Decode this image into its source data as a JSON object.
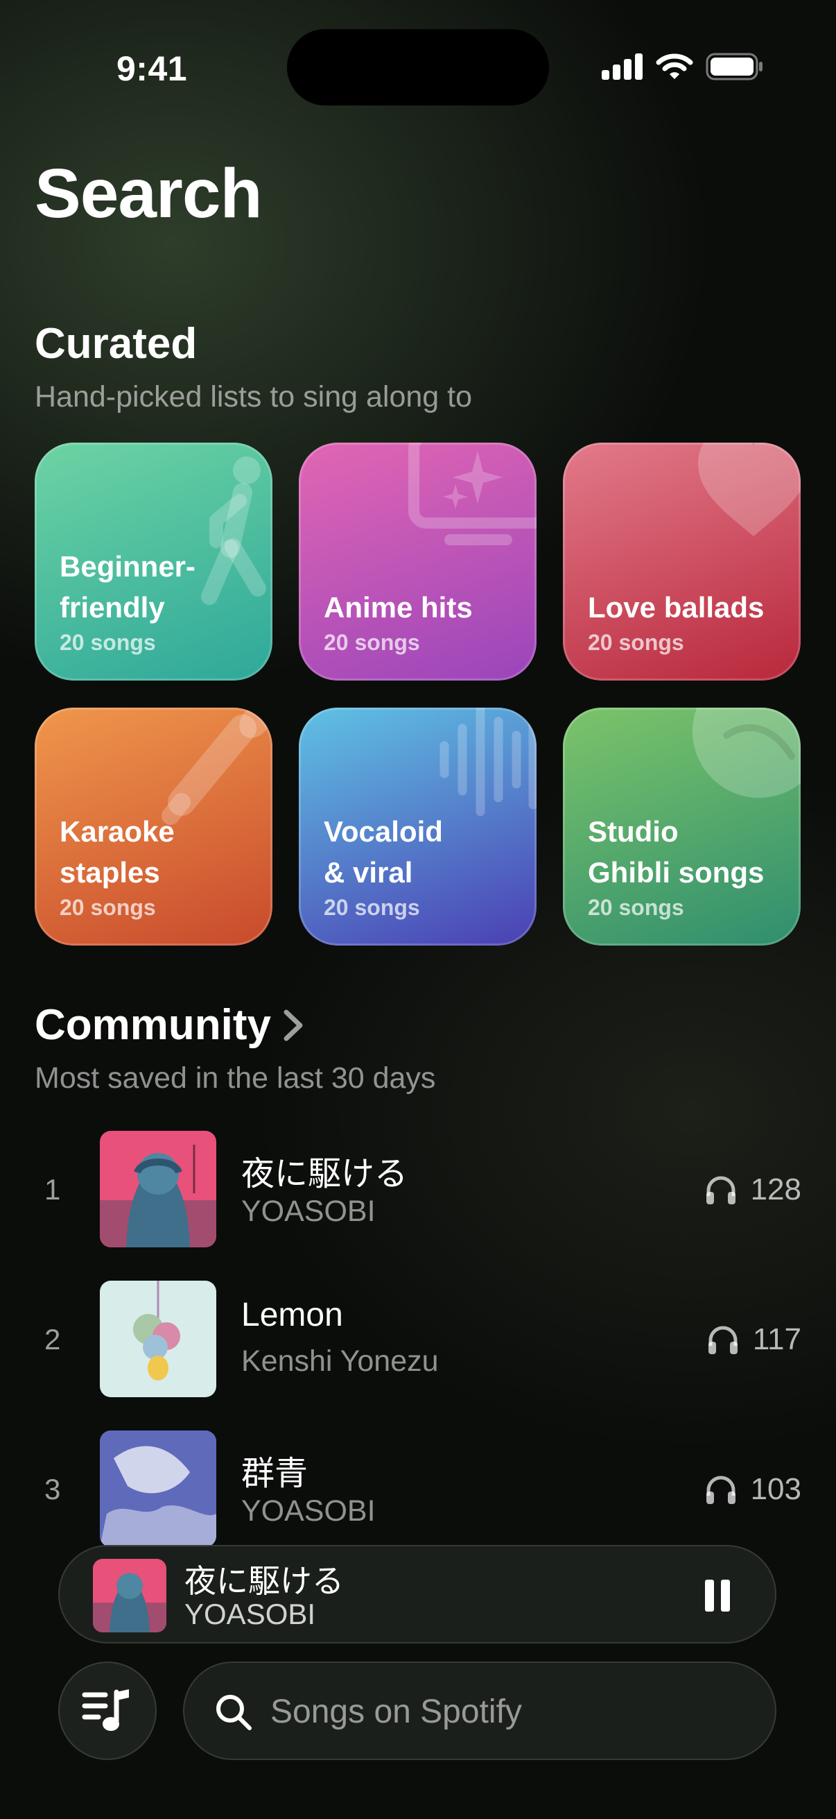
{
  "status_bar": {
    "time": "9:41"
  },
  "page": {
    "title": "Search"
  },
  "curated": {
    "title": "Curated",
    "subtitle": "Hand-picked lists to sing along to",
    "tiles": [
      {
        "title": "Beginner-\nfriendly",
        "count": "20 songs",
        "icon": "walking-person-icon",
        "colors": [
          "#6dd3a3",
          "#2ea89a"
        ]
      },
      {
        "title": "Anime hits",
        "count": "20 songs",
        "icon": "tv-sparkle-icon",
        "colors": [
          "#e266b3",
          "#9a45bb"
        ]
      },
      {
        "title": "Love ballads",
        "count": "20 songs",
        "icon": "heart-icon",
        "colors": [
          "#e27a8a",
          "#b8283b"
        ]
      },
      {
        "title": "Karaoke\nstaples",
        "count": "20 songs",
        "icon": "microphone-icon",
        "colors": [
          "#f0974c",
          "#c84a2c"
        ]
      },
      {
        "title": "Vocaloid\n& viral",
        "count": "20 songs",
        "icon": "waveform-icon",
        "colors": [
          "#5fc2e4",
          "#4b3fb3"
        ]
      },
      {
        "title": "Studio\nGhibli songs",
        "count": "20 songs",
        "icon": "leaf-icon",
        "colors": [
          "#7cc46a",
          "#2f8e6e"
        ]
      }
    ]
  },
  "community": {
    "title": "Community",
    "subtitle": "Most saved in the last 30 days",
    "rows": [
      {
        "rank": "1",
        "song": "夜に駆ける",
        "artist": "YOASOBI",
        "plays": "128"
      },
      {
        "rank": "2",
        "song": "Lemon",
        "artist": "Kenshi Yonezu",
        "plays": "117"
      },
      {
        "rank": "3",
        "song": "群青",
        "artist": "YOASOBI",
        "plays": "103"
      }
    ]
  },
  "now_playing": {
    "title": "夜に駆ける",
    "artist": "YOASOBI",
    "state": "playing"
  },
  "search": {
    "placeholder": "Songs on Spotify"
  }
}
